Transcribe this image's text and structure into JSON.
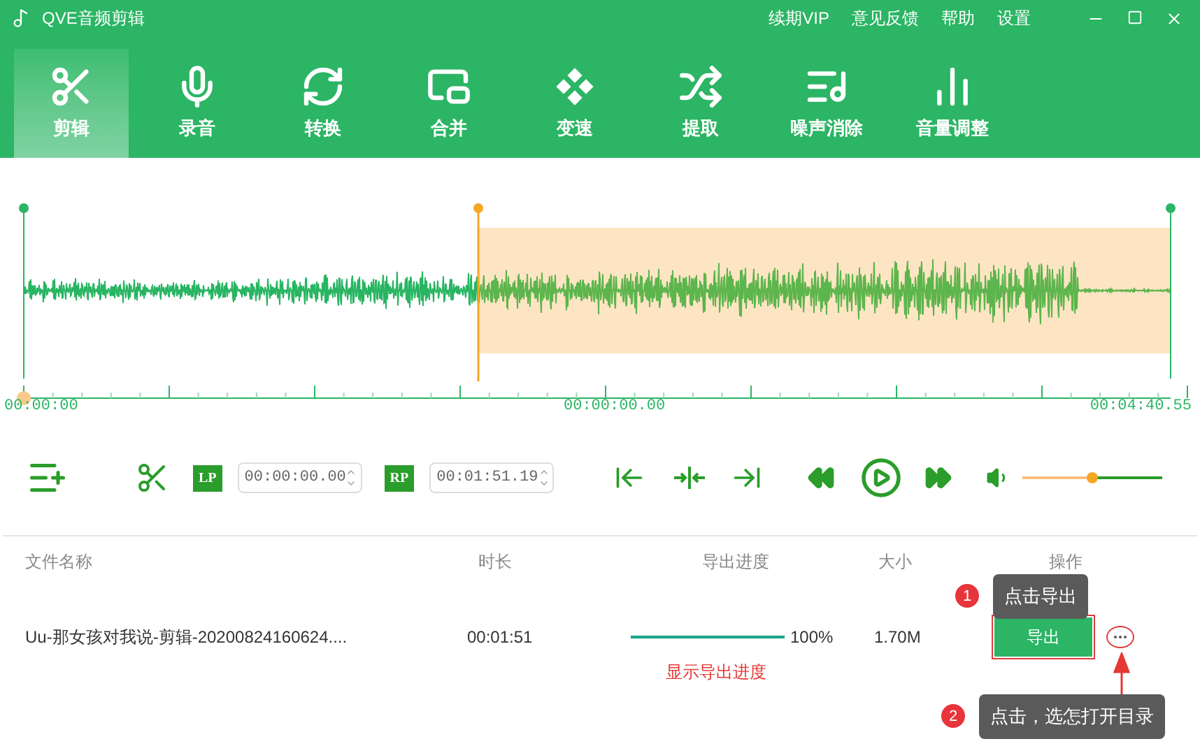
{
  "window": {
    "title": "QVE音频剪辑",
    "links": [
      "续期VIP",
      "意见反馈",
      "帮助",
      "设置"
    ]
  },
  "tools": [
    {
      "label": "剪辑",
      "selected": true
    },
    {
      "label": "录音",
      "selected": false
    },
    {
      "label": "转换",
      "selected": false
    },
    {
      "label": "合并",
      "selected": false
    },
    {
      "label": "变速",
      "selected": false
    },
    {
      "label": "提取",
      "selected": false
    },
    {
      "label": "噪声消除",
      "selected": false
    },
    {
      "label": "音量调整",
      "selected": false
    }
  ],
  "waveform": {
    "start_time": "00:00:00",
    "cursor_time": "00:00:00.00",
    "end_time": "00:04:40.55"
  },
  "controls": {
    "lp_label": "LP",
    "start_value": "00:00:00.00",
    "rp_label": "RP",
    "end_value": "00:01:51.19",
    "volume": {
      "level": 0.5
    }
  },
  "table": {
    "columns": [
      "文件名称",
      "时长",
      "导出进度",
      "大小",
      "操作"
    ],
    "rows": [
      {
        "name": "Uu-那女孩对我说-剪辑-20200824160624....",
        "duration": "00:01:51",
        "progress": {
          "level": 1
        },
        "percent": "100%",
        "size": "1.70M",
        "action": "导出"
      }
    ]
  },
  "annotations": {
    "progress_note": "显示导出进度",
    "steps": [
      {
        "number": "1",
        "text": "点击导出"
      },
      {
        "number": "2",
        "text": "点击，选怎打开目录"
      }
    ]
  }
}
